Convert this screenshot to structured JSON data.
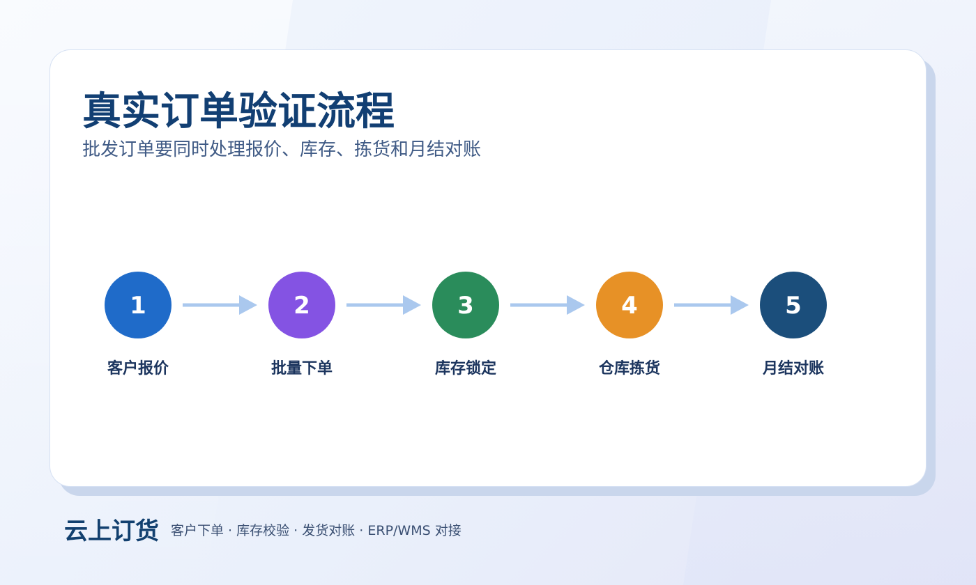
{
  "title": "真实订单验证流程",
  "subtitle": "批发订单要同时处理报价、库存、拣货和月结对账",
  "steps": [
    {
      "number": "1",
      "label": "客户报价",
      "color": "#1f6bc9"
    },
    {
      "number": "2",
      "label": "批量下单",
      "color": "#8453e3"
    },
    {
      "number": "3",
      "label": "库存锁定",
      "color": "#2a8c5b"
    },
    {
      "number": "4",
      "label": "仓库拣货",
      "color": "#e79126"
    },
    {
      "number": "5",
      "label": "月结对账",
      "color": "#1b4e7b"
    }
  ],
  "arrow_color": "#aac8ee",
  "footer": {
    "brand": "云上订货",
    "tagline": "客户下单 · 库存校验 · 发货对账 · ERP/WMS 对接"
  }
}
